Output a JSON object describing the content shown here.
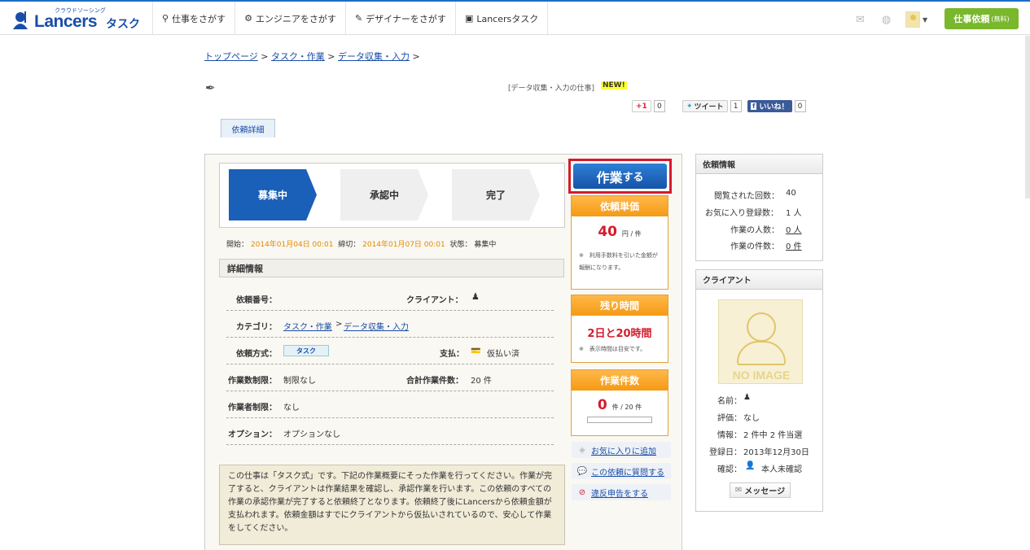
{
  "header": {
    "logo_sub": "クラウドソーシング",
    "logo_text": "Lancers",
    "logo_task": "タスク",
    "nav": [
      {
        "label": "仕事をさがす"
      },
      {
        "label": "エンジニアをさがす"
      },
      {
        "label": "デザイナーをさがす"
      },
      {
        "label": "Lancersタスク"
      }
    ],
    "request_button": "仕事依頼",
    "request_button_sub": "(無料)"
  },
  "breadcrumb": {
    "items": [
      "トップページ",
      "タスク・作業",
      "データ収集・入力"
    ],
    "sep": ">"
  },
  "job": {
    "category_tag": "[データ収集・入力の仕事]",
    "new_badge": "NEW!"
  },
  "social": {
    "gplus_label": "+1",
    "gplus_count": "0",
    "tweet_label": "ツイート",
    "tweet_count": "1",
    "like_label": "いいね！",
    "like_count": "0"
  },
  "tabs": {
    "detail": "依頼詳細"
  },
  "steps": [
    "募集中",
    "承認中",
    "完了"
  ],
  "dates": {
    "start_label": "開始：",
    "start": "2014年01月04日 00:01",
    "end_label": "締切：",
    "end": "2014年01月07日 00:01",
    "status_label": "状態：",
    "status": "募集中"
  },
  "details": {
    "title": "詳細情報",
    "number_label": "依頼番号：",
    "client_label": "クライアント：",
    "category_label": "カテゴリ：",
    "category_1": "タスク・作業",
    "category_2": "データ収集・入力",
    "method_label": "依頼方式：",
    "method": "タスク",
    "payment_label": "支払：",
    "payment": "仮払い済",
    "limit_label": "作業数制限：",
    "limit": "制限なし",
    "total_label": "合計作業件数：",
    "total": "20 件",
    "worker_limit_label": "作業者制限：",
    "worker_limit": "なし",
    "option_label": "オプション：",
    "option": "オプションなし"
  },
  "description": "この仕事は「タスク式」です。下記の作業概要にそった作業を行ってください。作業が完了すると、クライアントは作業結果を確認し、承認作業を行います。この依頼のすべての作業の承認作業が完了すると依頼終了となります。依頼終了後にLancersから依頼金額が支払われます。依頼金額はすでにクライアントから仮払いされているので、安心して作業をしてください。",
  "action": {
    "work_button_main": "作業",
    "work_button_sub": "する"
  },
  "price": {
    "title": "依頼単価",
    "value": "40",
    "unit": "円 / 件",
    "note": "※　利用手数料を引いた金額が報酬になります。"
  },
  "remaining": {
    "title": "残り時間",
    "value": "2日と20時間",
    "note": "※　表示時間は目安です。"
  },
  "count": {
    "title": "作業件数",
    "value": "0",
    "unit": "件 / 20 件",
    "progress": 0
  },
  "links": {
    "favorite": "お気に入りに追加",
    "question": "この依頼に質問する",
    "report": "違反申告をする"
  },
  "request_info": {
    "title": "依頼情報",
    "views_label": "閲覧された回数：",
    "views": "40",
    "fav_label": "お気に入り登録数：",
    "fav": "1 人",
    "workers_label": "作業の人数：",
    "workers": "0 人",
    "tasks_label": "作業の件数：",
    "tasks": "0 件"
  },
  "client": {
    "title": "クライアント",
    "no_image": "NO IMAGE",
    "name_label": "名前：",
    "rating_label": "評価：",
    "rating": "なし",
    "info_label": "情報：",
    "info": "2 件中 2 件当選",
    "registered_label": "登録日：",
    "registered": "2013年12月30日",
    "verify_label": "確認：",
    "verify": "本人未確認",
    "message_button": "メッセージ"
  }
}
